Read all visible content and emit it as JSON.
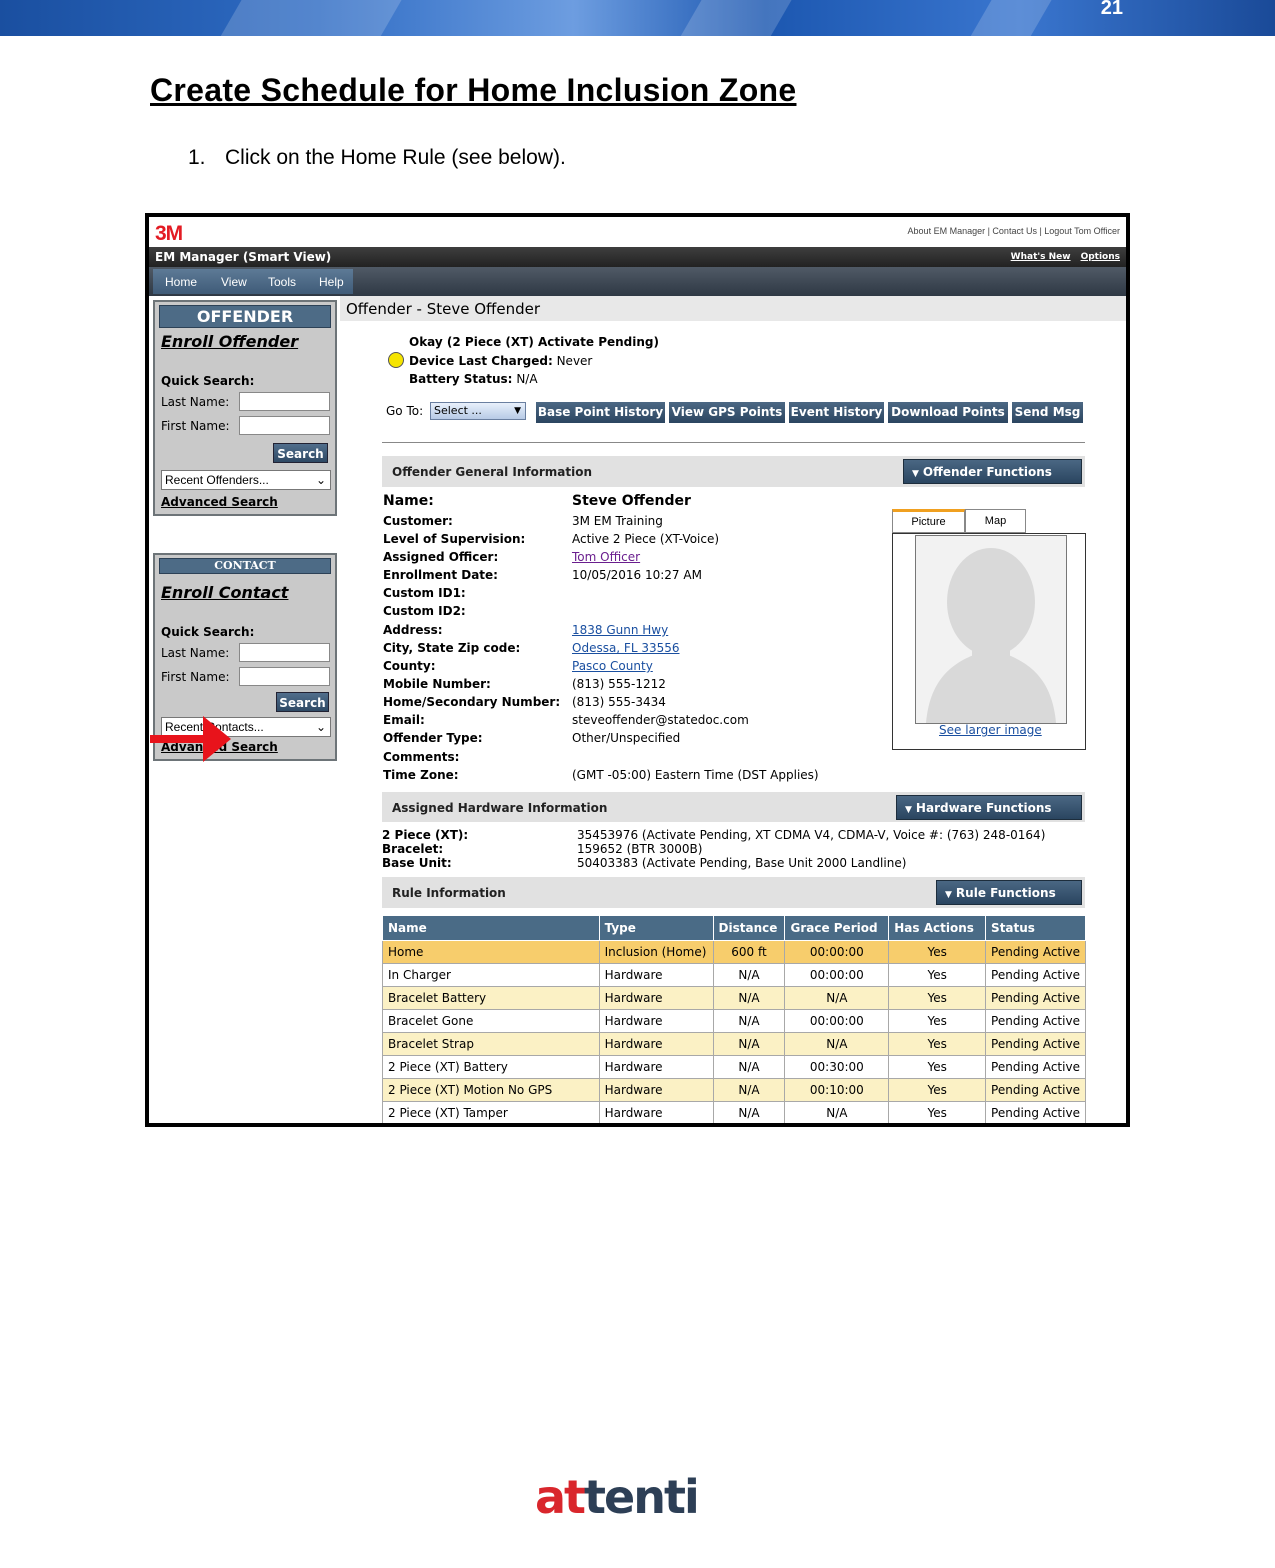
{
  "document": {
    "page_number": "21",
    "title": "Create Schedule for Home Inclusion Zone",
    "step_number": "1.",
    "step_text": "Click on the Home Rule (see below)."
  },
  "app": {
    "logo": "3M",
    "top_links": "About EM Manager | Contact Us | Logout Tom Officer",
    "window_title": "EM Manager (Smart View)",
    "whats_new": "What's New",
    "options": "Options",
    "menu": [
      "Home",
      "View",
      "Tools",
      "Help"
    ]
  },
  "sidebar": {
    "offender": {
      "header": "OFFENDER",
      "enroll": "Enroll Offender",
      "quick_search": "Quick Search:",
      "last_name": "Last Name:",
      "first_name": "First Name:",
      "search_button": "Search",
      "recent": "Recent Offenders...",
      "advanced": "Advanced Search"
    },
    "contact": {
      "header": "CONTACT",
      "enroll": "Enroll Contact",
      "quick_search": "Quick Search:",
      "last_name": "Last Name:",
      "first_name": "First Name:",
      "search_button": "Search",
      "recent": "Recent Contacts...",
      "advanced": "Advanced Search"
    }
  },
  "offender": {
    "heading": "Offender - Steve Offender",
    "status_line": "Okay (2 Piece (XT) Activate Pending)",
    "charged_label": "Device Last Charged:",
    "charged_value": "Never",
    "battery_label": "Battery Status:",
    "battery_value": "N/A",
    "status_color": "#f5e400",
    "goto_label": "Go To:",
    "goto_select": "Select ...",
    "goto_buttons": [
      "Base Point History",
      "View GPS Points",
      "Event History",
      "Download Points",
      "Send Msg"
    ]
  },
  "general": {
    "section_title": "Offender General Information",
    "functions_button": "Offender Functions",
    "name_label": "Name:",
    "name_value": "Steve Offender",
    "fields": [
      {
        "label": "Customer:",
        "value": "3M EM Training"
      },
      {
        "label": "Level of Supervision:",
        "value": "Active 2 Piece (XT-Voice)"
      },
      {
        "label": "Assigned Officer:",
        "value": "Tom Officer"
      },
      {
        "label": "Enrollment Date:",
        "value": "10/05/2016 10:27 AM"
      },
      {
        "label": "Custom ID1:",
        "value": ""
      },
      {
        "label": "Custom ID2:",
        "value": ""
      },
      {
        "label": "Address:",
        "value": "1838 Gunn Hwy"
      },
      {
        "label": "City, State Zip code:",
        "value": "Odessa, FL 33556"
      },
      {
        "label": "County:",
        "value": "Pasco County"
      },
      {
        "label": "Mobile Number:",
        "value": "(813) 555-1212"
      },
      {
        "label": "Home/Secondary Number:",
        "value": "(813) 555-3434"
      },
      {
        "label": "Email:",
        "value": "steveoffender@statedoc.com"
      },
      {
        "label": "Offender Type:",
        "value": "Other/Unspecified"
      },
      {
        "label": "Comments:",
        "value": ""
      },
      {
        "label": "Time Zone:",
        "value": "(GMT -05:00) Eastern Time (DST Applies)"
      }
    ],
    "tabs": [
      "Picture",
      "Map"
    ],
    "larger_image": "See larger image"
  },
  "hardware": {
    "section_title": "Assigned Hardware Information",
    "functions_button": "Hardware Functions",
    "items": [
      {
        "label": "2 Piece (XT):",
        "value": "35453976 (Activate Pending, XT CDMA V4, CDMA-V, Voice #: (763) 248-0164)"
      },
      {
        "label": "Bracelet:",
        "value": "159652 (BTR 3000B)"
      },
      {
        "label": "Base Unit:",
        "value": "50403383 (Activate Pending, Base Unit 2000 Landline)"
      }
    ]
  },
  "rules": {
    "section_title": "Rule Information",
    "functions_button": "Rule Functions",
    "columns": [
      "Name",
      "Type",
      "Distance",
      "Grace Period",
      "Has Actions",
      "Status"
    ],
    "rows": [
      [
        "Home",
        "Inclusion (Home)",
        "600 ft",
        "00:00:00",
        "Yes",
        "Pending Active"
      ],
      [
        "In Charger",
        "Hardware",
        "N/A",
        "00:00:00",
        "Yes",
        "Pending Active"
      ],
      [
        "Bracelet Battery",
        "Hardware",
        "N/A",
        "N/A",
        "Yes",
        "Pending Active"
      ],
      [
        "Bracelet Gone",
        "Hardware",
        "N/A",
        "00:00:00",
        "Yes",
        "Pending Active"
      ],
      [
        "Bracelet Strap",
        "Hardware",
        "N/A",
        "N/A",
        "Yes",
        "Pending Active"
      ],
      [
        "2 Piece (XT) Battery",
        "Hardware",
        "N/A",
        "00:30:00",
        "Yes",
        "Pending Active"
      ],
      [
        "2 Piece (XT) Motion No GPS",
        "Hardware",
        "N/A",
        "00:10:00",
        "Yes",
        "Pending Active"
      ],
      [
        "2 Piece (XT) Tamper",
        "Hardware",
        "N/A",
        "N/A",
        "Yes",
        "Pending Active"
      ]
    ],
    "highlight_color": "#f7cd6c",
    "arrow_color": "#e8131b"
  },
  "footer": {
    "logo_part1": "at",
    "logo_part2": "tenti"
  }
}
